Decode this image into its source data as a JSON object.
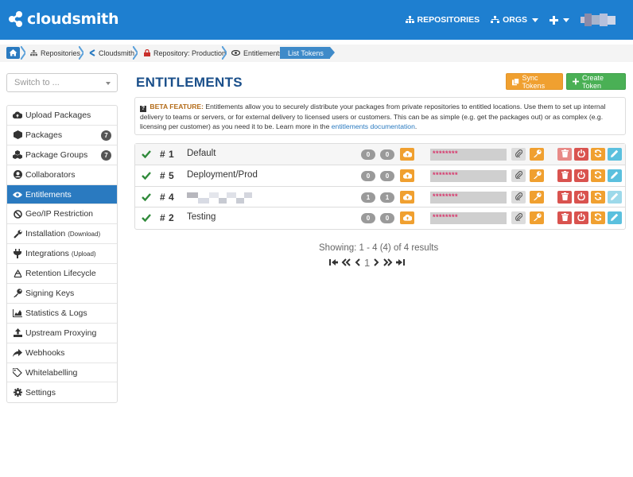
{
  "app": {
    "name": "cloudsmith"
  },
  "topnav": {
    "repositories": "REPOSITORIES",
    "orgs": "ORGS"
  },
  "breadcrumb": {
    "items": [
      "Repositories",
      "Cloudsmith",
      "Repository: Production",
      "Entitlements"
    ],
    "active": "List Tokens"
  },
  "sidebar": {
    "switch_placeholder": "Switch to ...",
    "items": [
      {
        "label": "Upload Packages",
        "icon": "cloud-upload-icon"
      },
      {
        "label": "Packages",
        "icon": "cube-icon",
        "badge": "7"
      },
      {
        "label": "Package Groups",
        "icon": "cubes-icon",
        "badge": "7"
      },
      {
        "label": "Collaborators",
        "icon": "user-circle-icon"
      },
      {
        "label": "Entitlements",
        "icon": "eye-icon",
        "active": true
      },
      {
        "label": "Geo/IP Restriction",
        "icon": "ban-icon"
      },
      {
        "label": "Installation",
        "sub": "(Download)",
        "icon": "wrench-icon"
      },
      {
        "label": "Integrations",
        "sub": "(Upload)",
        "icon": "plug-icon"
      },
      {
        "label": "Retention Lifecycle",
        "icon": "recycle-icon"
      },
      {
        "label": "Signing Keys",
        "icon": "key-icon"
      },
      {
        "label": "Statistics & Logs",
        "icon": "area-chart-icon"
      },
      {
        "label": "Upstream Proxying",
        "icon": "upload-icon"
      },
      {
        "label": "Webhooks",
        "icon": "share-icon"
      },
      {
        "label": "Whitelabelling",
        "icon": "tags-icon"
      },
      {
        "label": "Settings",
        "icon": "cog-icon"
      }
    ]
  },
  "main": {
    "title": "ENTITLEMENTS",
    "sync_label": "Sync Tokens",
    "create_label": "Create Token",
    "beta": {
      "label": "BETA FEATURE:",
      "text": "Entitlements allow you to securely distribute your packages from private repositories to entitled locations. Use them to set up internal delivery to teams or servers, or for external delivery to licensed users or customers. This can be as simple (e.g. get the packages out) or as complex (e.g. licensing per customer) as you need it to be. Learn more in the",
      "link": "entitlements documentation",
      "end": "."
    }
  },
  "tokens": [
    {
      "num": "# 1",
      "name": "Default",
      "count_a": "0",
      "count_b": "0",
      "token": "********"
    },
    {
      "num": "# 5",
      "name": "Deployment/Prod",
      "count_a": "0",
      "count_b": "0",
      "token": "********"
    },
    {
      "num": "# 4",
      "name": "",
      "count_a": "1",
      "count_b": "1",
      "token": "********"
    },
    {
      "num": "# 2",
      "name": "Testing",
      "count_a": "0",
      "count_b": "0",
      "token": "********"
    }
  ],
  "pagination": {
    "showing": "Showing: 1 - 4 (4) of 4 results",
    "current": "1"
  },
  "colors": {
    "brand": "#1e7fd0",
    "title": "#1a4f8a",
    "warning": "#f0a030",
    "success": "#4ab055",
    "danger": "#d9534f",
    "info": "#5bc0de"
  }
}
